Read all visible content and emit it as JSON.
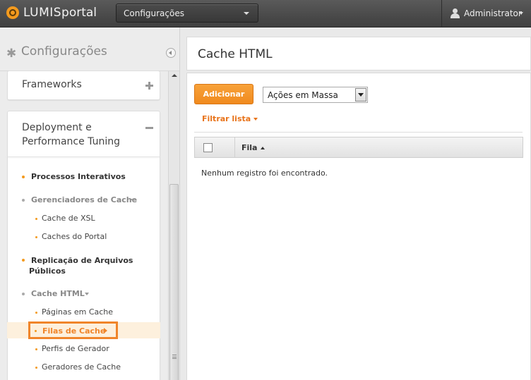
{
  "topbar": {
    "logo_lumis": "LUMIS",
    "logo_portal": "portal",
    "site_select": "Configurações",
    "user_name": "Administrator"
  },
  "sidebar": {
    "title": "Configurações",
    "cards": {
      "frameworks": "Frameworks",
      "deployment": "Deployment e Performance Tuning"
    },
    "items": [
      {
        "label": "Processos Interativos"
      },
      {
        "label": "Gerenciadores de Cache"
      },
      {
        "label": "Cache de XSL"
      },
      {
        "label": "Caches do Portal"
      },
      {
        "label": "Replicação de Arquivos Públicos"
      },
      {
        "label": "Cache HTML"
      },
      {
        "label": "Páginas em Cache"
      },
      {
        "label": "Filas de Cache"
      },
      {
        "label": "Perfis de Gerador"
      },
      {
        "label": "Geradores de Cache"
      }
    ]
  },
  "main": {
    "title": "Cache HTML",
    "add_button": "Adicionar",
    "bulk_actions": "Ações em Massa",
    "filter_link": "Filtrar lista",
    "table": {
      "columns": [
        "Fila"
      ]
    },
    "empty_message": "Nenhum registro foi encontrado."
  },
  "colors": {
    "accent": "#f0852a",
    "topbar": "#4a4a4a",
    "active_row": "#fdf0dd"
  }
}
